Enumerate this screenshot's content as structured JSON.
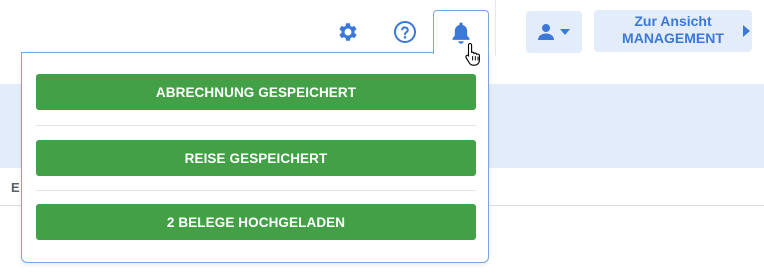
{
  "toolbar": {
    "icons": [
      "gear-icon",
      "help-icon",
      "bell-icon",
      "user-icon",
      "caret-down-icon"
    ],
    "view_switch": {
      "line1": "Zur Ansicht",
      "line2": "MANAGEMENT"
    }
  },
  "background": {
    "fragment_text": "E"
  },
  "notifications": {
    "items": [
      {
        "label": "ABRECHNUNG GESPEICHERT"
      },
      {
        "label": "REISE GESPEICHERT"
      },
      {
        "label": "2 BELEGE HOCHGELADEN"
      }
    ]
  },
  "colors": {
    "accent": "#3b78d8",
    "accent_light_bg": "#e3ecfa",
    "success": "#43a047",
    "panel_border": "#7aa6e0"
  }
}
